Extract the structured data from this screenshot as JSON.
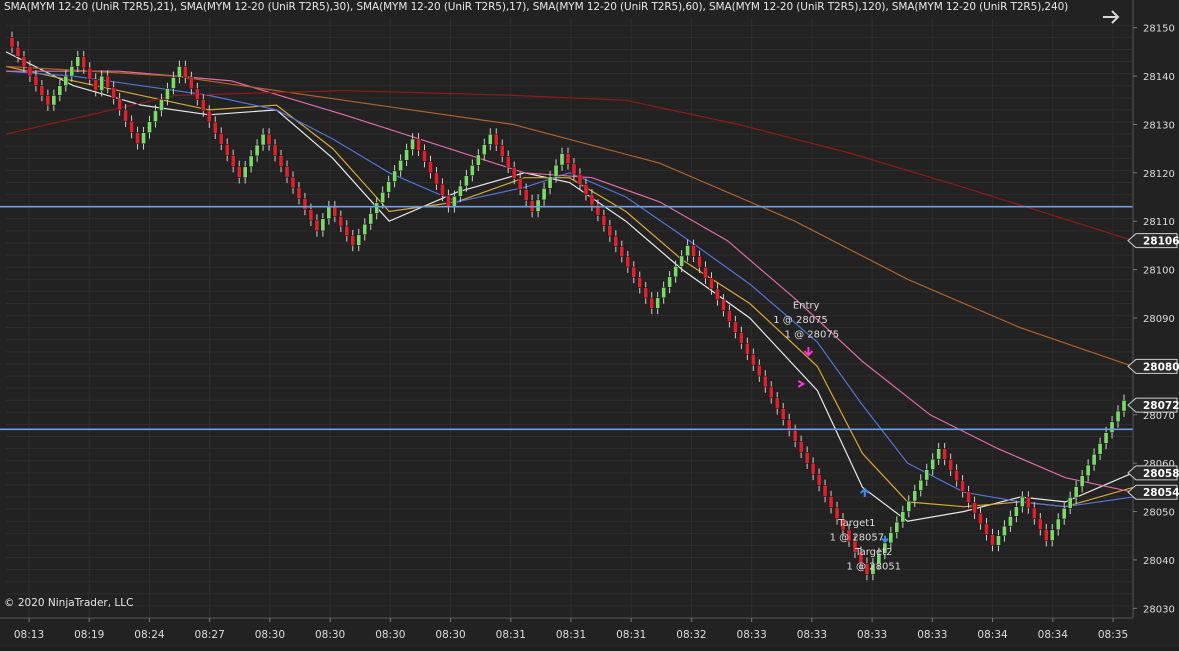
{
  "legend": "SMA(MYM 12-20 (UniR T2R5),21), SMA(MYM 12-20 (UniR T2R5),30), SMA(MYM 12-20 (UniR T2R5),17), SMA(MYM 12-20 (UniR T2R5),60), SMA(MYM 12-20 (UniR T2R5),120), SMA(MYM 12-20 (UniR T2R5),240)",
  "copyright": "© 2020 NinjaTrader, LLC",
  "nav_icon": "arrow-right-icon",
  "colors": {
    "background": "#222222",
    "grid": "#2d2d2d",
    "up_bar": "#77dd66",
    "down_bar": "#e0202a",
    "hline": "#6d9fe8",
    "sma17": "#e8e8e8",
    "sma21": "#d9a832",
    "sma30": "#4f74d8",
    "sma60": "#e06aa8",
    "sma120": "#b0622a",
    "sma240": "#8c1a1a"
  },
  "chart_data": {
    "type": "candlestick",
    "instrument": "MYM 12-20 (UniR T2R5)",
    "ylim": [
      28028,
      28152
    ],
    "y_ticks": [
      28030,
      28040,
      28050,
      28060,
      28070,
      28080,
      28090,
      28100,
      28110,
      28120,
      28130,
      28140,
      28150
    ],
    "x_labels": [
      "08:13",
      "08:19",
      "08:24",
      "08:27",
      "08:30",
      "08:30",
      "08:30",
      "08:30",
      "08:31",
      "08:31",
      "08:31",
      "08:32",
      "08:33",
      "08:33",
      "08:33",
      "08:33",
      "08:34",
      "08:34",
      "08:35"
    ],
    "price_path": [
      28148,
      28138,
      28134,
      28144,
      28137,
      28140,
      28126,
      28142,
      28119,
      28128,
      28108,
      28113,
      28105,
      28127,
      28113,
      28128,
      28112,
      28124,
      28092,
      28105,
      28060,
      28037,
      28063,
      28043,
      28053,
      28044,
      28073
    ],
    "horizontal_lines": [
      28113,
      28067
    ],
    "price_markers": [
      {
        "label": "28106",
        "value": 28106
      },
      {
        "label": "28080",
        "value": 28080
      },
      {
        "label": "28072",
        "value": 28072
      },
      {
        "label": "28058",
        "value": 28058
      },
      {
        "label": "28054",
        "value": 28054
      }
    ],
    "series": [
      {
        "name": "SMA(MYM 12-20 (UniR T2R5),17)",
        "color": "#e8e8e8",
        "points": [
          [
            0,
            28145
          ],
          [
            0.06,
            28138
          ],
          [
            0.12,
            28134
          ],
          [
            0.18,
            28132
          ],
          [
            0.24,
            28133
          ],
          [
            0.29,
            28123
          ],
          [
            0.34,
            28110
          ],
          [
            0.4,
            28116
          ],
          [
            0.46,
            28120
          ],
          [
            0.5,
            28118
          ],
          [
            0.55,
            28110
          ],
          [
            0.6,
            28100
          ],
          [
            0.66,
            28090
          ],
          [
            0.72,
            28075
          ],
          [
            0.76,
            28055
          ],
          [
            0.8,
            28048
          ],
          [
            0.85,
            28050
          ],
          [
            0.9,
            28053
          ],
          [
            0.94,
            28052
          ],
          [
            1.0,
            28058
          ]
        ]
      },
      {
        "name": "SMA(MYM 12-20 (UniR T2R5),21)",
        "color": "#d9a832",
        "points": [
          [
            0,
            28142
          ],
          [
            0.06,
            28139
          ],
          [
            0.12,
            28136
          ],
          [
            0.18,
            28133
          ],
          [
            0.24,
            28134
          ],
          [
            0.29,
            28125
          ],
          [
            0.34,
            28112
          ],
          [
            0.4,
            28114
          ],
          [
            0.46,
            28119
          ],
          [
            0.5,
            28119
          ],
          [
            0.55,
            28112
          ],
          [
            0.6,
            28102
          ],
          [
            0.66,
            28093
          ],
          [
            0.72,
            28080
          ],
          [
            0.76,
            28062
          ],
          [
            0.8,
            28052
          ],
          [
            0.85,
            28051
          ],
          [
            0.9,
            28052
          ],
          [
            0.94,
            28051
          ],
          [
            1.0,
            28055
          ]
        ]
      },
      {
        "name": "SMA(MYM 12-20 (UniR T2R5),30)",
        "color": "#4f74d8",
        "points": [
          [
            0,
            28141
          ],
          [
            0.06,
            28140
          ],
          [
            0.12,
            28138
          ],
          [
            0.18,
            28136
          ],
          [
            0.24,
            28133
          ],
          [
            0.29,
            28127
          ],
          [
            0.34,
            28120
          ],
          [
            0.4,
            28114
          ],
          [
            0.46,
            28117
          ],
          [
            0.5,
            28120
          ],
          [
            0.55,
            28115
          ],
          [
            0.6,
            28107
          ],
          [
            0.66,
            28097
          ],
          [
            0.72,
            28085
          ],
          [
            0.76,
            28072
          ],
          [
            0.8,
            28060
          ],
          [
            0.85,
            28054
          ],
          [
            0.9,
            28052
          ],
          [
            0.94,
            28051
          ],
          [
            1.0,
            28053
          ]
        ]
      },
      {
        "name": "SMA(MYM 12-20 (UniR T2R5),60)",
        "color": "#e06aa8",
        "points": [
          [
            0,
            28141
          ],
          [
            0.1,
            28141
          ],
          [
            0.2,
            28139
          ],
          [
            0.3,
            28132
          ],
          [
            0.38,
            28126
          ],
          [
            0.46,
            28120
          ],
          [
            0.52,
            28119
          ],
          [
            0.58,
            28114
          ],
          [
            0.64,
            28106
          ],
          [
            0.7,
            28094
          ],
          [
            0.76,
            28081
          ],
          [
            0.82,
            28070
          ],
          [
            0.88,
            28063
          ],
          [
            0.94,
            28057
          ],
          [
            1.0,
            28054
          ]
        ]
      },
      {
        "name": "SMA(MYM 12-20 (UniR T2R5),120)",
        "color": "#b0622a",
        "points": [
          [
            0,
            28142
          ],
          [
            0.15,
            28140
          ],
          [
            0.3,
            28135
          ],
          [
            0.45,
            28130
          ],
          [
            0.58,
            28122
          ],
          [
            0.7,
            28110
          ],
          [
            0.8,
            28098
          ],
          [
            0.9,
            28088
          ],
          [
            1.0,
            28080
          ]
        ]
      },
      {
        "name": "SMA(MYM 12-20 (UniR T2R5),240)",
        "color": "#8c1a1a",
        "points": [
          [
            0,
            28128
          ],
          [
            0.15,
            28136
          ],
          [
            0.3,
            28137
          ],
          [
            0.45,
            28136
          ],
          [
            0.55,
            28135
          ],
          [
            0.65,
            28130
          ],
          [
            0.75,
            28124
          ],
          [
            0.85,
            28117
          ],
          [
            1.0,
            28106
          ]
        ]
      }
    ],
    "annotations": [
      {
        "text": "Entry",
        "value": 28092,
        "x_frac": 0.71
      },
      {
        "text": "1 @ 28075",
        "value": 28089,
        "x_frac": 0.705
      },
      {
        "text": "1 @ 28075",
        "value": 28086,
        "x_frac": 0.715
      },
      {
        "text": "Target1",
        "value": 28047,
        "x_frac": 0.755
      },
      {
        "text": "1 @ 28057",
        "value": 28044,
        "x_frac": 0.755
      },
      {
        "text": "Target2",
        "value": 28041,
        "x_frac": 0.77
      },
      {
        "text": "1 @ 28051",
        "value": 28038,
        "x_frac": 0.77
      }
    ],
    "grid": true
  }
}
